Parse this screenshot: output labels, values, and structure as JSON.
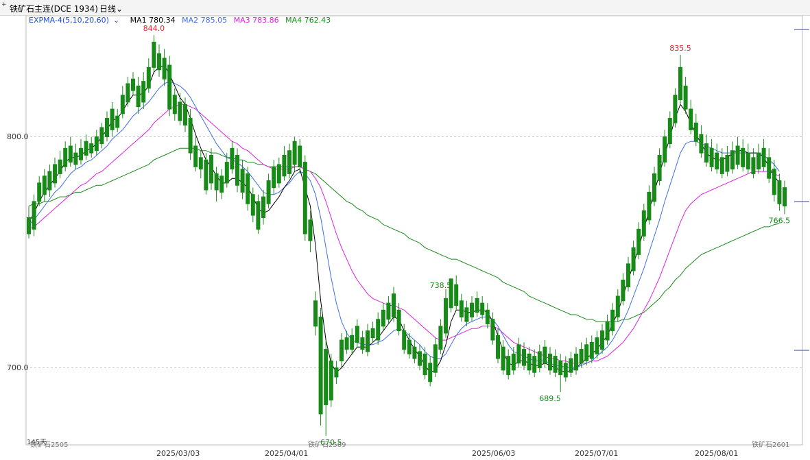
{
  "header": {
    "plus": "+",
    "title": "铁矿石主连(DCE 1934)",
    "period": "日线"
  },
  "legend": {
    "indicator": "EXPMA-4(5,10,20,60)",
    "ma1_label": "MA1 780.34",
    "ma2_label": "MA2 785.05",
    "ma3_label": "MA3 783.86",
    "ma4_label": "MA4 762.43"
  },
  "colors": {
    "up": "#e8202a",
    "down": "#178a17",
    "ma1": "#000000",
    "ma2": "#3d6ee8",
    "ma3": "#e020e0",
    "ma4": "#178a17",
    "grid": "#c8c8c8",
    "panel": "#f4f4f4"
  },
  "footer": {
    "count": "145天",
    "contract_left": "铁矿石2505",
    "contract_mid": "铁矿石2509",
    "contract_right": "铁矿石2601"
  },
  "chart_data": {
    "type": "candlestick",
    "title": "铁矿石主连(DCE 1934)",
    "ylim": [
      655,
      855
    ],
    "y_ticks": [
      700.0,
      800.0
    ],
    "y_tick_labels": [
      "700.0",
      "800.0"
    ],
    "x_labels": [
      "2025/03/03",
      "2025/04/01",
      "2025/06/03",
      "2025/07/01",
      "2025/08/01"
    ],
    "x_label_index": [
      30,
      51,
      92,
      112,
      135
    ],
    "grid": "dashed horizontal",
    "annotations": [
      {
        "label": "844.0",
        "index": 24,
        "value": 844.0
      },
      {
        "label": "670.5",
        "index": 58,
        "value": 670.5
      },
      {
        "label": "738.5",
        "index": 79,
        "value": 738.5
      },
      {
        "label": "689.5",
        "index": 100,
        "value": 689.5
      },
      {
        "label": "835.5",
        "index": 125,
        "value": 835.5
      },
      {
        "label": "766.5",
        "index": 144,
        "value": 766.5
      }
    ],
    "candles": [
      [
        765,
        758,
        770,
        756
      ],
      [
        772,
        760,
        775,
        757
      ],
      [
        780,
        772,
        783,
        770
      ],
      [
        783,
        775,
        786,
        772
      ],
      [
        785,
        777,
        788,
        774
      ],
      [
        788,
        780,
        791,
        778
      ],
      [
        790,
        784,
        794,
        782
      ],
      [
        795,
        787,
        798,
        785
      ],
      [
        796,
        789,
        800,
        787
      ],
      [
        793,
        788,
        797,
        786
      ],
      [
        795,
        790,
        799,
        788
      ],
      [
        798,
        792,
        801,
        790
      ],
      [
        797,
        793,
        800,
        791
      ],
      [
        800,
        794,
        803,
        792
      ],
      [
        804,
        797,
        806,
        795
      ],
      [
        808,
        800,
        811,
        798
      ],
      [
        812,
        803,
        815,
        800
      ],
      [
        809,
        804,
        812,
        802
      ],
      [
        818,
        810,
        822,
        808
      ],
      [
        823,
        815,
        826,
        813
      ],
      [
        825,
        820,
        828,
        818
      ],
      [
        822,
        813,
        826,
        810
      ],
      [
        824,
        815,
        828,
        812
      ],
      [
        830,
        821,
        834,
        819
      ],
      [
        841,
        830,
        844,
        828
      ],
      [
        836,
        829,
        840,
        826
      ],
      [
        834,
        825,
        838,
        822
      ],
      [
        831,
        812,
        835,
        809
      ],
      [
        818,
        810,
        821,
        807
      ],
      [
        815,
        807,
        819,
        805
      ],
      [
        814,
        805,
        817,
        802
      ],
      [
        808,
        793,
        812,
        790
      ],
      [
        796,
        787,
        800,
        785
      ],
      [
        791,
        786,
        794,
        782
      ],
      [
        790,
        777,
        793,
        775
      ],
      [
        792,
        780,
        795,
        777
      ],
      [
        784,
        777,
        787,
        772
      ],
      [
        783,
        776,
        786,
        773
      ],
      [
        789,
        780,
        793,
        778
      ],
      [
        795,
        786,
        798,
        784
      ],
      [
        792,
        779,
        795,
        776
      ],
      [
        786,
        776,
        790,
        773
      ],
      [
        784,
        771,
        787,
        768
      ],
      [
        775,
        766,
        778,
        763
      ],
      [
        772,
        760,
        775,
        758
      ],
      [
        774,
        765,
        777,
        762
      ],
      [
        781,
        771,
        784,
        769
      ],
      [
        787,
        778,
        790,
        775
      ],
      [
        788,
        780,
        791,
        778
      ],
      [
        792,
        783,
        796,
        781
      ],
      [
        794,
        784,
        797,
        782
      ],
      [
        798,
        788,
        800,
        785
      ],
      [
        796,
        787,
        799,
        784
      ],
      [
        789,
        758,
        792,
        755
      ],
      [
        764,
        755,
        768,
        750
      ],
      [
        729,
        718,
        733,
        714
      ],
      [
        722,
        680,
        726,
        675
      ],
      [
        708,
        684,
        712,
        670.5
      ],
      [
        703,
        686,
        706,
        683
      ],
      [
        700,
        696,
        703,
        693
      ],
      [
        712,
        703,
        715,
        700
      ],
      [
        713,
        708,
        716,
        706
      ],
      [
        714,
        708,
        717,
        706
      ],
      [
        718,
        711,
        721,
        709
      ],
      [
        713,
        708,
        716,
        706
      ],
      [
        716,
        707,
        719,
        705
      ],
      [
        717,
        713,
        720,
        711
      ],
      [
        721,
        712,
        724,
        710
      ],
      [
        725,
        718,
        728,
        716
      ],
      [
        728,
        721,
        731,
        719
      ],
      [
        732,
        722,
        735,
        720
      ],
      [
        725,
        716,
        728,
        714
      ],
      [
        716,
        708,
        719,
        706
      ],
      [
        712,
        706,
        715,
        704
      ],
      [
        709,
        704,
        712,
        702
      ],
      [
        707,
        701,
        710,
        699
      ],
      [
        706,
        697,
        709,
        695
      ],
      [
        702,
        694,
        705,
        692
      ],
      [
        710,
        698,
        713,
        696
      ],
      [
        718,
        708,
        721,
        706
      ],
      [
        730,
        715,
        734,
        713
      ],
      [
        738.5,
        726,
        738.5,
        724
      ],
      [
        736,
        727,
        740,
        725
      ],
      [
        729,
        722,
        732,
        720
      ],
      [
        726,
        720,
        729,
        718
      ],
      [
        728,
        722,
        731,
        720
      ],
      [
        730,
        724,
        733,
        722
      ],
      [
        728,
        723,
        731,
        721
      ],
      [
        725,
        719,
        728,
        717
      ],
      [
        721,
        712,
        724,
        710
      ],
      [
        714,
        704,
        717,
        702
      ],
      [
        709,
        699,
        712,
        697
      ],
      [
        705,
        697,
        708,
        695
      ],
      [
        706,
        699,
        709,
        697
      ],
      [
        710,
        702,
        713,
        700
      ],
      [
        708,
        701,
        711,
        699
      ],
      [
        706,
        699,
        709,
        697
      ],
      [
        705,
        698,
        708,
        696
      ],
      [
        707,
        700,
        710,
        698
      ],
      [
        709,
        702,
        712,
        700
      ],
      [
        706,
        699,
        709,
        697
      ],
      [
        705,
        698,
        708,
        696
      ],
      [
        703,
        697,
        706,
        689.5
      ],
      [
        702,
        696,
        705,
        694
      ],
      [
        704,
        698,
        707,
        696
      ],
      [
        706,
        699,
        709,
        697
      ],
      [
        708,
        702,
        711,
        700
      ],
      [
        710,
        703,
        713,
        701
      ],
      [
        711,
        704,
        714,
        702
      ],
      [
        713,
        706,
        716,
        704
      ],
      [
        716,
        708,
        719,
        706
      ],
      [
        720,
        712,
        723,
        710
      ],
      [
        725,
        716,
        728,
        714
      ],
      [
        731,
        722,
        734,
        720
      ],
      [
        738,
        729,
        741,
        727
      ],
      [
        745,
        735,
        748,
        733
      ],
      [
        752,
        742,
        755,
        740
      ],
      [
        760,
        749,
        763,
        747
      ],
      [
        768,
        757,
        771,
        755
      ],
      [
        776,
        764,
        779,
        762
      ],
      [
        784,
        772,
        787,
        770
      ],
      [
        792,
        781,
        795,
        779
      ],
      [
        800,
        789,
        803,
        787
      ],
      [
        808,
        797,
        811,
        795
      ],
      [
        818,
        806,
        821,
        804
      ],
      [
        830,
        816,
        835.5,
        814
      ],
      [
        822,
        812,
        826,
        810
      ],
      [
        812,
        803,
        816,
        801
      ],
      [
        806,
        798,
        810,
        796
      ],
      [
        801,
        793,
        805,
        791
      ],
      [
        797,
        789,
        801,
        787
      ],
      [
        795,
        787,
        799,
        785
      ],
      [
        793,
        786,
        797,
        784
      ],
      [
        791,
        784,
        795,
        782
      ],
      [
        792,
        785,
        796,
        783
      ],
      [
        794,
        786,
        798,
        784
      ],
      [
        796,
        788,
        800,
        786
      ],
      [
        795,
        787,
        799,
        785
      ],
      [
        793,
        786,
        797,
        784
      ],
      [
        791,
        784,
        795,
        782
      ],
      [
        793,
        786,
        797,
        784
      ],
      [
        795,
        787,
        799,
        785
      ],
      [
        791,
        782,
        795,
        780
      ],
      [
        786,
        775,
        790,
        772
      ],
      [
        781,
        771,
        784,
        768
      ],
      [
        778,
        770,
        781,
        766.5
      ]
    ],
    "ma1": [
      763,
      767,
      772,
      776,
      779,
      782,
      785,
      789,
      791,
      791,
      792,
      794,
      795,
      797,
      800,
      803,
      807,
      808,
      811,
      815,
      818,
      818,
      819,
      822,
      828,
      830,
      831,
      827,
      822,
      817,
      814,
      808,
      801,
      795,
      790,
      787,
      783,
      780,
      780,
      782,
      782,
      780,
      778,
      774,
      769,
      767,
      768,
      771,
      774,
      778,
      781,
      785,
      786,
      778,
      770,
      753,
      729,
      712,
      702,
      698,
      700,
      703,
      706,
      709,
      709,
      709,
      711,
      713,
      716,
      719,
      722,
      721,
      716,
      712,
      708,
      705,
      701,
      698,
      699,
      703,
      710,
      720,
      725,
      725,
      724,
      724,
      725,
      725,
      724,
      720,
      714,
      707,
      702,
      701,
      703,
      703,
      702,
      701,
      701,
      702,
      701,
      700,
      699,
      698,
      699,
      700,
      702,
      704,
      706,
      708,
      711,
      714,
      719,
      724,
      731,
      738,
      745,
      752,
      760,
      768,
      776,
      784,
      792,
      800,
      808,
      814,
      811,
      806,
      801,
      797,
      793,
      791,
      790,
      790,
      791,
      793,
      794,
      794,
      793,
      793,
      793,
      791,
      787,
      783,
      780
    ],
    "ma2": [
      762,
      764,
      767,
      770,
      773,
      776,
      778,
      781,
      784,
      786,
      787,
      789,
      790,
      792,
      794,
      796,
      799,
      801,
      803,
      806,
      809,
      811,
      813,
      815,
      818,
      821,
      823,
      824,
      823,
      822,
      820,
      817,
      813,
      809,
      805,
      801,
      797,
      794,
      791,
      790,
      789,
      787,
      785,
      782,
      779,
      776,
      775,
      775,
      776,
      778,
      780,
      783,
      785,
      784,
      781,
      775,
      765,
      752,
      739,
      728,
      720,
      715,
      712,
      711,
      710,
      710,
      710,
      711,
      712,
      714,
      716,
      717,
      716,
      714,
      712,
      710,
      707,
      705,
      704,
      704,
      706,
      710,
      714,
      717,
      719,
      720,
      721,
      722,
      722,
      721,
      718,
      714,
      710,
      707,
      706,
      705,
      704,
      703,
      703,
      703,
      702,
      701,
      701,
      700,
      700,
      700,
      701,
      702,
      703,
      705,
      707,
      709,
      712,
      716,
      720,
      725,
      731,
      737,
      743,
      750,
      757,
      764,
      772,
      779,
      786,
      793,
      797,
      798,
      798,
      797,
      796,
      795,
      794,
      793,
      793,
      793,
      793,
      793,
      793,
      793,
      793,
      792,
      790,
      788,
      785
    ],
    "ma3": [
      760,
      761,
      763,
      765,
      767,
      769,
      771,
      773,
      775,
      777,
      779,
      780,
      782,
      784,
      785,
      787,
      789,
      791,
      793,
      795,
      797,
      799,
      801,
      803,
      806,
      808,
      810,
      812,
      813,
      814,
      814,
      813,
      812,
      810,
      808,
      806,
      804,
      802,
      800,
      798,
      797,
      795,
      794,
      792,
      790,
      788,
      787,
      786,
      786,
      786,
      786,
      787,
      787,
      786,
      785,
      782,
      778,
      772,
      765,
      758,
      752,
      747,
      742,
      738,
      735,
      732,
      730,
      729,
      728,
      727,
      727,
      726,
      725,
      723,
      721,
      719,
      717,
      715,
      713,
      712,
      712,
      713,
      714,
      715,
      716,
      717,
      717,
      718,
      718,
      718,
      717,
      715,
      713,
      711,
      710,
      709,
      708,
      707,
      706,
      705,
      704,
      704,
      703,
      703,
      702,
      702,
      702,
      702,
      703,
      703,
      704,
      705,
      707,
      709,
      711,
      714,
      717,
      721,
      725,
      729,
      734,
      739,
      745,
      751,
      757,
      763,
      768,
      771,
      773,
      775,
      776,
      777,
      778,
      779,
      780,
      781,
      782,
      783,
      784,
      785,
      785,
      785,
      785,
      784,
      783
    ],
    "ma4": [
      770,
      771,
      771,
      772,
      772,
      773,
      774,
      774,
      775,
      776,
      776,
      777,
      778,
      779,
      779,
      780,
      781,
      782,
      783,
      784,
      785,
      786,
      787,
      788,
      790,
      791,
      792,
      793,
      794,
      795,
      795,
      795,
      795,
      794,
      794,
      793,
      793,
      792,
      791,
      791,
      790,
      790,
      789,
      789,
      788,
      788,
      787,
      787,
      787,
      787,
      787,
      787,
      787,
      786,
      785,
      784,
      782,
      780,
      778,
      776,
      774,
      772,
      771,
      769,
      768,
      766,
      765,
      764,
      762,
      761,
      760,
      759,
      758,
      756,
      755,
      754,
      752,
      751,
      750,
      749,
      748,
      747,
      747,
      746,
      745,
      744,
      743,
      742,
      741,
      740,
      739,
      737,
      736,
      735,
      734,
      733,
      731,
      730,
      729,
      728,
      727,
      726,
      725,
      724,
      723,
      723,
      722,
      721,
      721,
      720,
      720,
      720,
      720,
      720,
      721,
      721,
      722,
      723,
      724,
      726,
      728,
      730,
      733,
      735,
      738,
      740,
      743,
      745,
      747,
      749,
      750,
      751,
      752,
      753,
      754,
      755,
      756,
      757,
      758,
      759,
      760,
      761,
      761,
      762,
      762.43
    ]
  }
}
